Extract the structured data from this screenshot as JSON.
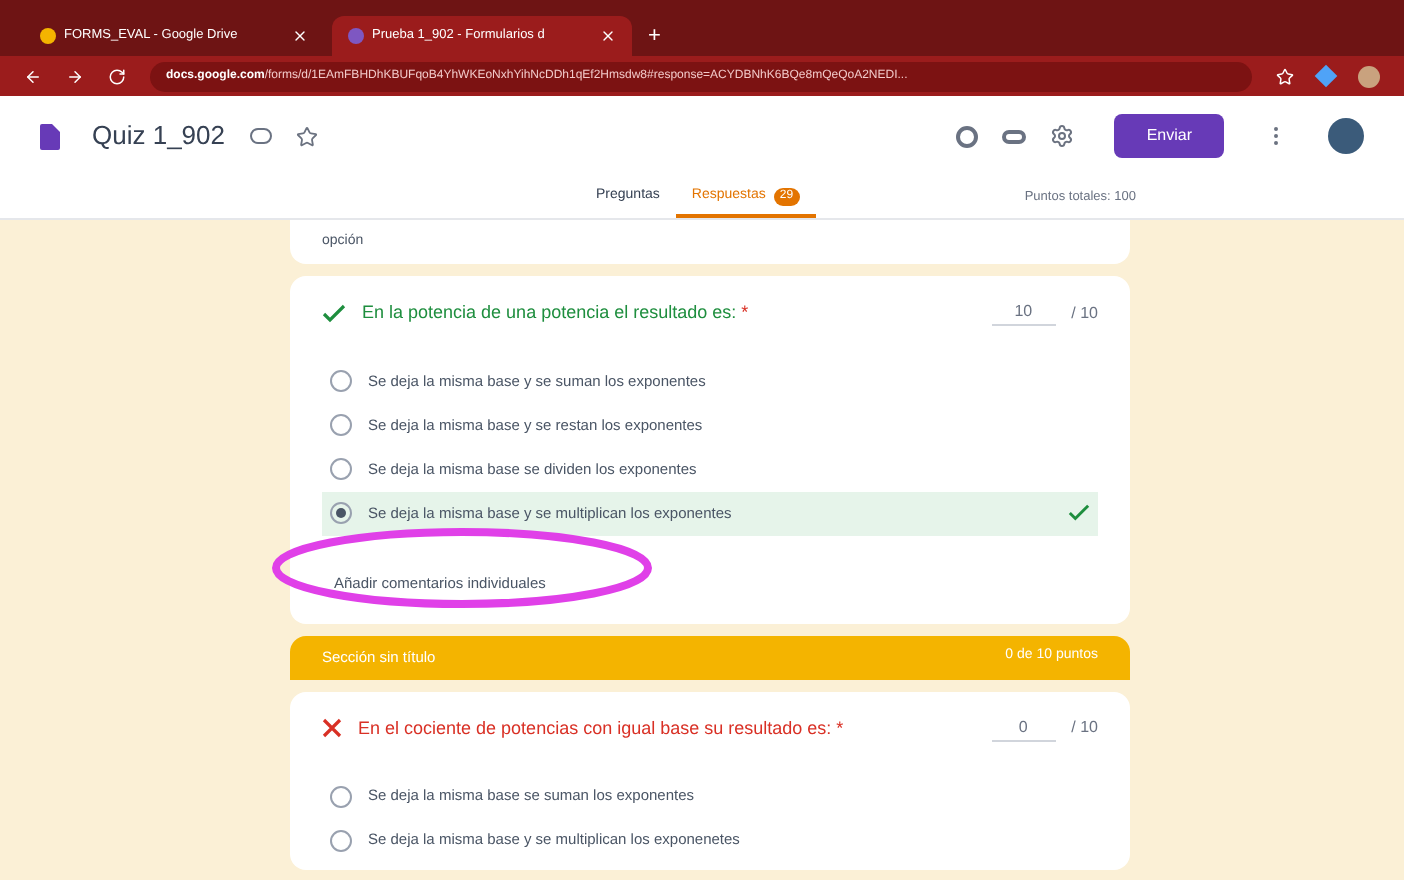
{
  "browser": {
    "tabs": [
      {
        "title": "FORMS_EVAL - Google Drive",
        "selected": false
      },
      {
        "title": "Prueba 1_902 - Formularios d",
        "selected": true
      }
    ],
    "new_tab": "+",
    "url_host": "docs.google.com",
    "url_path": "/forms/d/1EAmFBHDhKBUFqoB4YhWKEoNxhYihNcDDh1qEf2Hmsdw8#response=ACYDBNhK6BQe8mQeQoA2NEDI..."
  },
  "form": {
    "title": "Quiz 1_902",
    "send_button": "Enviar",
    "tabs": [
      {
        "label": "Preguntas",
        "selected": false
      },
      {
        "label": "Respuestas",
        "selected": true,
        "badge": "29"
      }
    ],
    "total_points": "Puntos totales: 100"
  },
  "partial_text": "opción",
  "questions": [
    {
      "text": "En la potencia de una potencia el resultado es:",
      "required_mark": "*",
      "correct": true,
      "score": "10",
      "max": "/ 10",
      "options": [
        {
          "label": "Se deja la misma base y se suman los exponentes",
          "selected": false
        },
        {
          "label": "Se deja la misma base y se restan los exponentes",
          "selected": false
        },
        {
          "label": "Se deja la misma base se dividen los exponentes",
          "selected": false
        },
        {
          "label": "Se deja la misma base y se multiplican los exponentes",
          "selected": true
        }
      ],
      "feedback_link": "Añadir comentarios individuales"
    }
  ],
  "section": {
    "title": "Sección sin título",
    "points": "0 de 10 puntos"
  },
  "questions_2": [
    {
      "text": "En el cociente de potencias con igual base su resultado es:",
      "required_mark": "*",
      "correct": false,
      "score": "0",
      "max": "/ 10",
      "options": [
        {
          "label": "Se deja la misma base se suman los exponentes",
          "selected": false
        },
        {
          "label": "Se deja la misma base y se multiplican los exponenetes",
          "selected": false
        }
      ]
    }
  ]
}
